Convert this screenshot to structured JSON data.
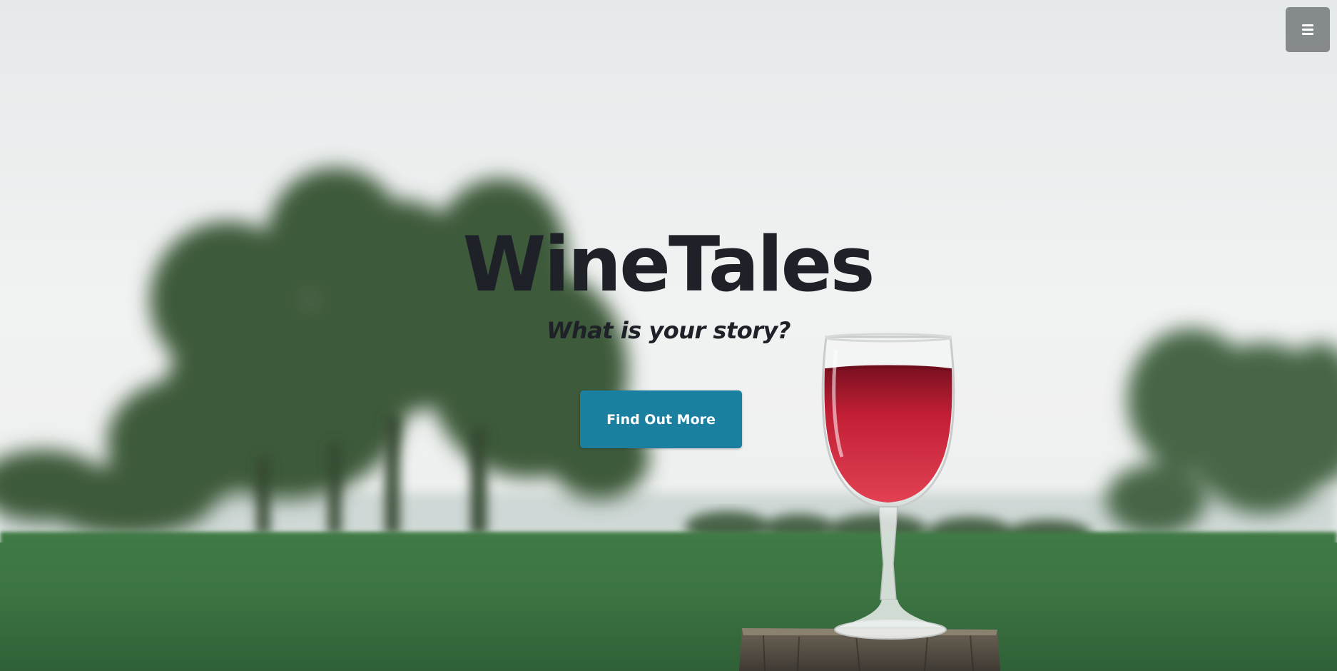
{
  "brand": {
    "title": "WineTales",
    "tagline": "What is your story?"
  },
  "hero": {
    "cta_label": "Find Out More"
  },
  "nav": {
    "menu_icon": "hamburger-menu-icon"
  },
  "colors": {
    "text": "#1e2127",
    "cta_background": "#1b7fa0",
    "menu_background": "#7c8084"
  }
}
